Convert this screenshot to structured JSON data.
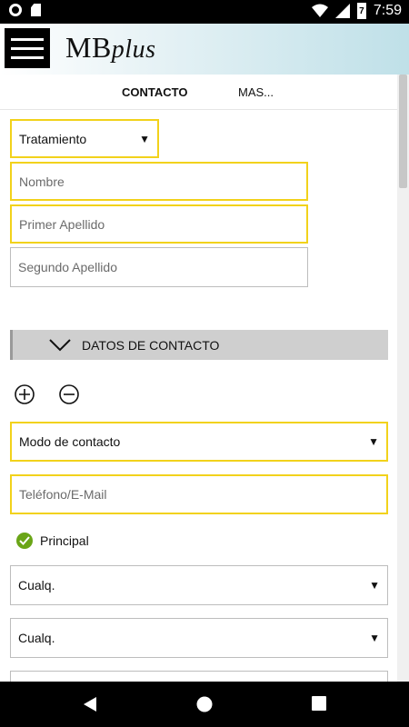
{
  "status_bar": {
    "time": "7:59",
    "battery_level": "7"
  },
  "app_bar": {
    "logo_main": "MB",
    "logo_suffix": "plus"
  },
  "tabs": [
    {
      "label": "CONTACTO",
      "active": true
    },
    {
      "label": "MAS...",
      "active": false
    }
  ],
  "form": {
    "tratamiento": {
      "value": "Tratamiento"
    },
    "nombre": {
      "placeholder": "Nombre"
    },
    "primer_apellido": {
      "placeholder": "Primer Apellido"
    },
    "segundo_apellido": {
      "placeholder": "Segundo Apellido"
    }
  },
  "section": {
    "title": "DATOS DE CONTACTO"
  },
  "contact": {
    "modo": {
      "value": "Modo de contacto"
    },
    "telefono": {
      "placeholder": "Teléfono/E-Mail"
    },
    "principal_label": "Principal",
    "select1": {
      "value": "Cualq."
    },
    "select2": {
      "value": "Cualq."
    }
  },
  "colors": {
    "accent_yellow": "#f2d21b",
    "check_green": "#6aa517",
    "section_gray": "#cfcfcf"
  },
  "icons": [
    "menu-icon",
    "add-circle-icon",
    "remove-circle-icon",
    "check-circle-icon",
    "chevron-down-icon",
    "back-icon",
    "home-icon",
    "recents-icon"
  ]
}
